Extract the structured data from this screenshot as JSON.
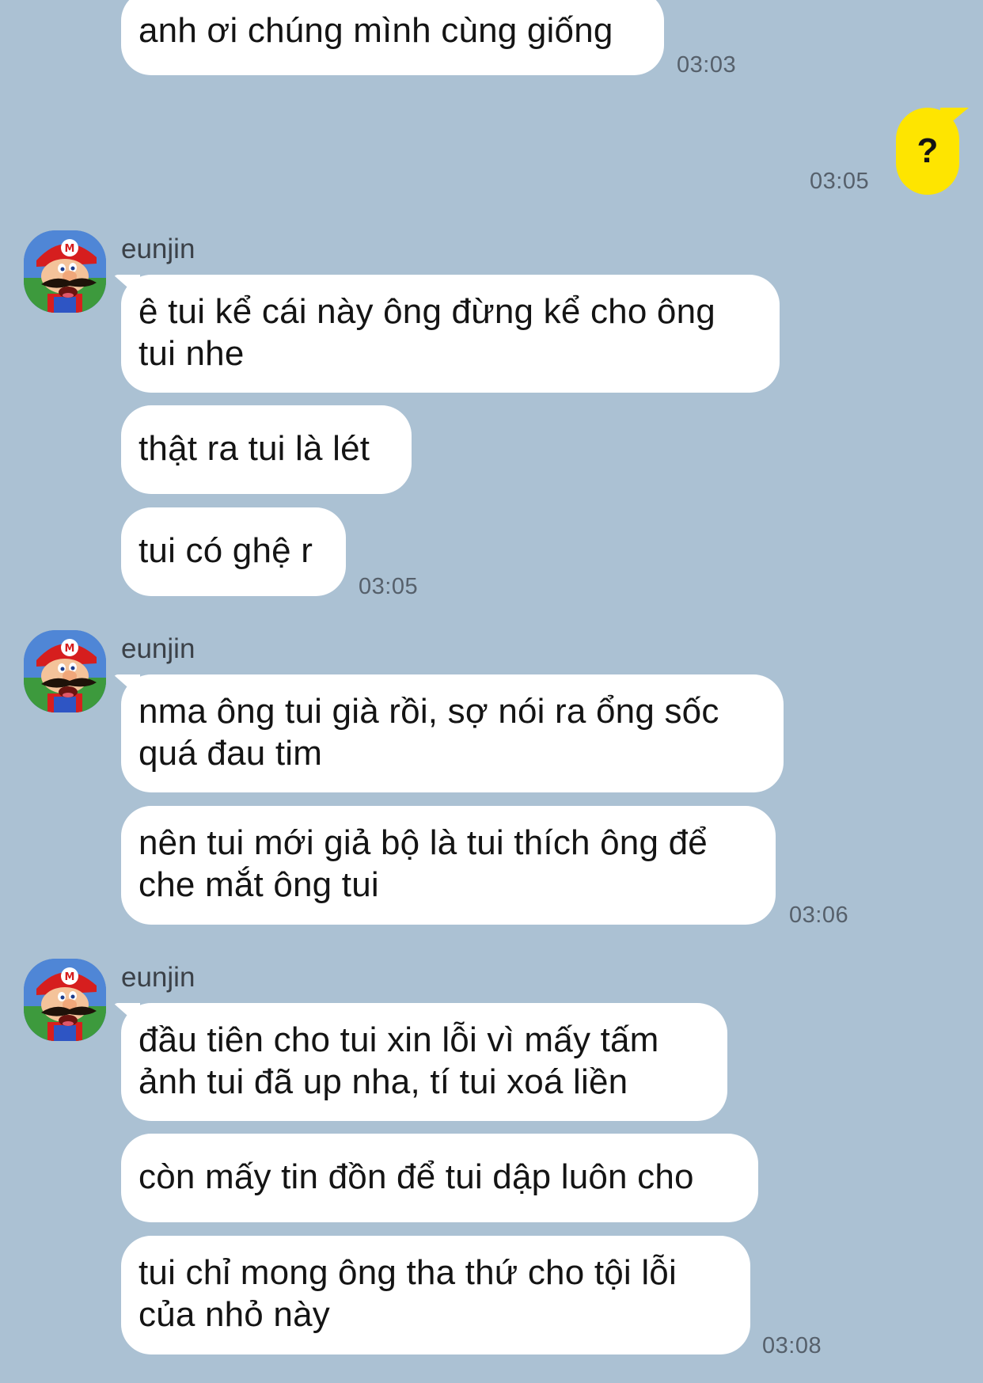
{
  "conversation": {
    "messages": [
      {
        "text": "anh ơi chúng mình cùng giống",
        "time": "03:03"
      },
      {
        "text": "?",
        "time": "03:05"
      },
      {
        "sender": "eunjin",
        "text": "ê tui kể cái này ông đừng kể cho ông\ntui nhe"
      },
      {
        "text": "thật ra tui là lét"
      },
      {
        "text": "tui có ghệ r",
        "time": "03:05"
      },
      {
        "sender": "eunjin",
        "text": "nma ông tui già rồi, sợ nói ra ổng sốc\nquá đau tim"
      },
      {
        "text": "nên tui mới giả bộ là tui thích ông để\nche mắt ông tui",
        "time": "03:06"
      },
      {
        "sender": "eunjin",
        "text": "đầu tiên cho tui xin lỗi vì mấy tấm\nảnh tui đã up nha, tí tui xoá liền"
      },
      {
        "text": "còn mấy tin đồn để tui dập luôn cho"
      },
      {
        "text": "tui chỉ mong ông tha thứ cho tội lỗi\ncủa nhỏ này",
        "time": "03:08"
      }
    ]
  },
  "colors": {
    "background": "#abc1d3",
    "incoming_bubble": "#ffffff",
    "outgoing_bubble": "#fee500"
  },
  "icons": {
    "avatar": "mario-avatar-icon"
  }
}
